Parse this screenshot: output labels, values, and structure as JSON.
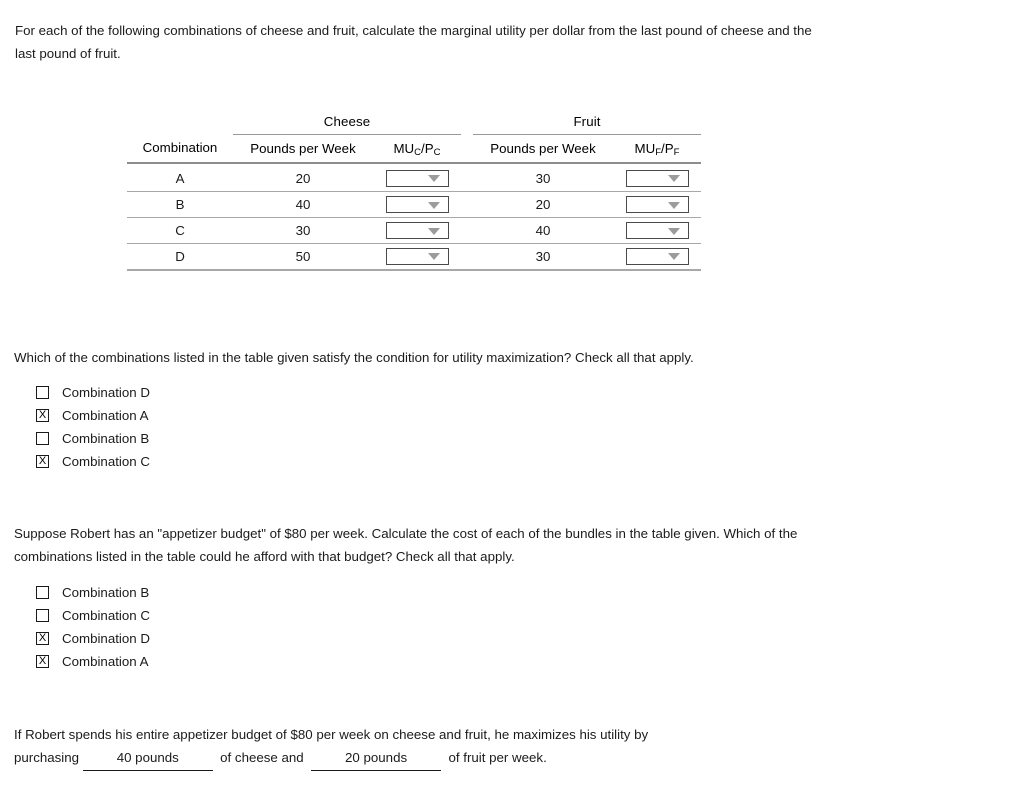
{
  "intro": {
    "text": "For each of the following combinations of cheese and fruit, calculate the marginal utility per dollar from the last pound of cheese and the last pound of fruit."
  },
  "table": {
    "group_headers": {
      "cheese": "Cheese",
      "fruit": "Fruit"
    },
    "column_headers": {
      "combination": "Combination",
      "cheese_pounds": "Pounds per Week",
      "cheese_mu": "MU_C/P_C",
      "fruit_pounds": "Pounds per Week",
      "fruit_mu": "MU_F/P_F"
    },
    "mu_parts": {
      "cheese": {
        "mu": "MU",
        "mu_sub": "C",
        "slash": "/",
        "p": "P",
        "p_sub": "C"
      },
      "fruit": {
        "mu": "MU",
        "mu_sub": "F",
        "slash": "/",
        "p": "P",
        "p_sub": "F"
      }
    },
    "rows": [
      {
        "combination": "A",
        "cheese_pounds": "20",
        "cheese_mu": "",
        "fruit_pounds": "30",
        "fruit_mu": ""
      },
      {
        "combination": "B",
        "cheese_pounds": "40",
        "cheese_mu": "",
        "fruit_pounds": "20",
        "fruit_mu": ""
      },
      {
        "combination": "C",
        "cheese_pounds": "30",
        "cheese_mu": "",
        "fruit_pounds": "40",
        "fruit_mu": ""
      },
      {
        "combination": "D",
        "cheese_pounds": "50",
        "cheese_mu": "",
        "fruit_pounds": "30",
        "fruit_mu": ""
      }
    ],
    "dropdown_icon": "chevron-down-icon"
  },
  "question1": {
    "prompt": "Which of the combinations listed in the table given satisfy the condition for utility maximization? Check all that apply.",
    "options": [
      {
        "label": "Combination D",
        "checked": false,
        "mark": ""
      },
      {
        "label": "Combination A",
        "checked": true,
        "mark": "X"
      },
      {
        "label": "Combination B",
        "checked": false,
        "mark": ""
      },
      {
        "label": "Combination C",
        "checked": true,
        "mark": "X"
      }
    ]
  },
  "question2": {
    "prompt": "Suppose Robert has an \"appetizer budget\" of $80 per week. Calculate the cost of each of the bundles in the table given. Which of the combinations listed in the table could he afford with that budget? Check all that apply.",
    "options": [
      {
        "label": "Combination B",
        "checked": false,
        "mark": ""
      },
      {
        "label": "Combination C",
        "checked": false,
        "mark": ""
      },
      {
        "label": "Combination D",
        "checked": true,
        "mark": "X"
      },
      {
        "label": "Combination A",
        "checked": true,
        "mark": "X"
      }
    ]
  },
  "closing": {
    "line1": "If Robert spends his entire appetizer budget of $80 per week on cheese and fruit, he maximizes his utility by",
    "before_blank1": "purchasing ",
    "blank1": "40 pounds",
    "between_blanks": "  of cheese and  ",
    "blank2": "20 pounds",
    "after_blank2": "  of fruit per week."
  },
  "colors": {
    "text": "#1b1b1b",
    "rule": "#a8a8a8",
    "header_rule": "#8d8d8d",
    "dropdown_border": "#4a4a4a",
    "dropdown_arrow": "#9b9b9b",
    "background": "#ffffff"
  }
}
